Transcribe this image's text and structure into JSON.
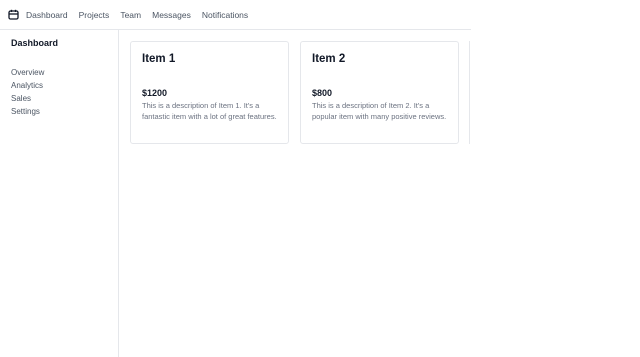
{
  "nav": {
    "logo_icon": "calendar-icon",
    "items": [
      "Dashboard",
      "Projects",
      "Team",
      "Messages",
      "Notifications"
    ]
  },
  "sidebar": {
    "title": "Dashboard",
    "items": [
      "Overview",
      "Analytics",
      "Sales",
      "Settings"
    ]
  },
  "cards": [
    {
      "title": "Item 1",
      "price": "$1200",
      "description": "This is a description of Item 1. It's a fantastic item with a lot of great features."
    },
    {
      "title": "Item 2",
      "price": "$800",
      "description": "This is a description of Item 2. It's a popular item with many positive reviews."
    }
  ]
}
